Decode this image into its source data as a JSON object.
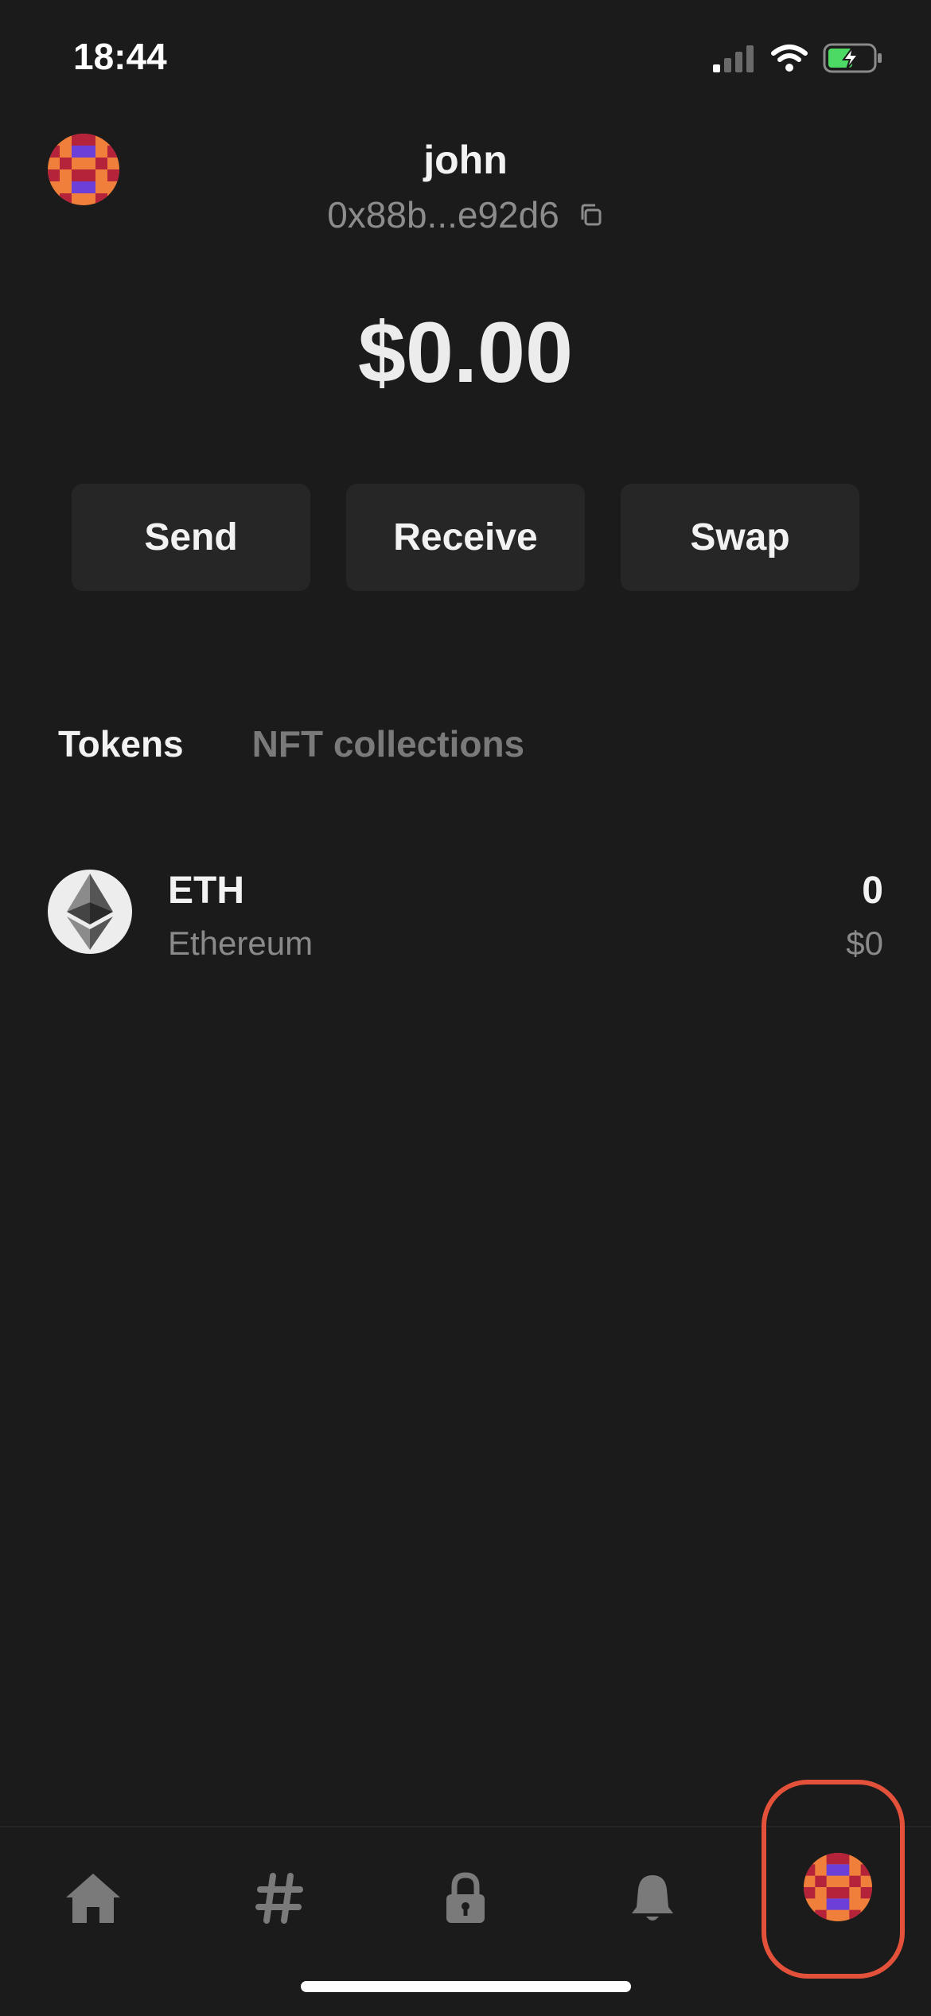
{
  "status_bar": {
    "time": "18:44"
  },
  "header": {
    "name": "john",
    "address": "0x88b...e92d6",
    "icons": [
      "avatar",
      "copy-icon"
    ]
  },
  "balance": "$0.00",
  "actions": {
    "send": "Send",
    "receive": "Receive",
    "swap": "Swap"
  },
  "tabs": [
    {
      "label": "Tokens",
      "active": true
    },
    {
      "label": "NFT collections",
      "active": false
    }
  ],
  "tokens": [
    {
      "symbol": "ETH",
      "name": "Ethereum",
      "amount": "0",
      "fiat": "$0",
      "icon": "ethereum-logo-icon"
    }
  ],
  "nav": [
    "home-icon",
    "hashtag-icon",
    "lock-icon",
    "bell-icon",
    "profile-avatar"
  ],
  "colors": {
    "background": "#1b1b1b",
    "button": "#262626",
    "highlight": "#e4513a",
    "muted_text": "#8c8c8c",
    "battery": "#4cd964"
  }
}
